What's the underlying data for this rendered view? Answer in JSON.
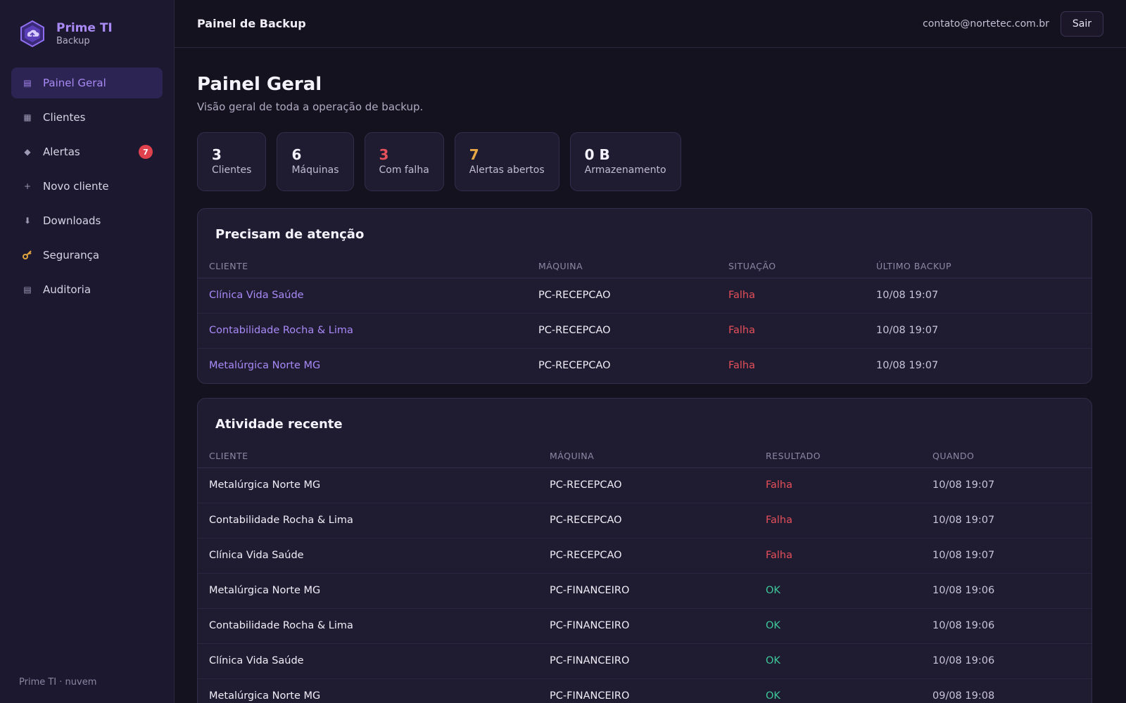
{
  "brand": {
    "name": "Prime TI",
    "subtitle": "Backup"
  },
  "sidebar": {
    "items": [
      {
        "label": "Painel Geral",
        "icon": "dashboard-icon",
        "active": true
      },
      {
        "label": "Clientes",
        "icon": "grid-icon"
      },
      {
        "label": "Alertas",
        "icon": "diamond-icon",
        "badge": "7"
      },
      {
        "label": "Novo cliente",
        "icon": "plus-icon"
      },
      {
        "label": "Downloads",
        "icon": "download-icon"
      },
      {
        "label": "Segurança",
        "icon": "key-icon"
      },
      {
        "label": "Auditoria",
        "icon": "list-icon"
      }
    ],
    "footer": "Prime TI · nuvem"
  },
  "topbar": {
    "title": "Painel de Backup",
    "user_email": "contato@nortetec.com.br",
    "logout_label": "Sair"
  },
  "page": {
    "title": "Painel Geral",
    "subtitle": "Visão geral de toda a operação de backup."
  },
  "stats": [
    {
      "value": "3",
      "label": "Clientes"
    },
    {
      "value": "6",
      "label": "Máquinas"
    },
    {
      "value": "3",
      "label": "Com falha",
      "color": "#e5505a"
    },
    {
      "value": "7",
      "label": "Alertas abertos",
      "color": "#e7a845"
    },
    {
      "value": "0 B",
      "label": "Armazenamento"
    }
  ],
  "attention": {
    "title": "Precisam de atenção",
    "columns": [
      "CLIENTE",
      "MÁQUINA",
      "SITUAÇÃO",
      "ÚLTIMO BACKUP"
    ],
    "rows": [
      {
        "client": "Clínica Vida Saúde",
        "machine": "PC-RECEPCAO",
        "status": "Falha",
        "last_backup": "10/08 19:07"
      },
      {
        "client": "Contabilidade Rocha & Lima",
        "machine": "PC-RECEPCAO",
        "status": "Falha",
        "last_backup": "10/08 19:07"
      },
      {
        "client": "Metalúrgica Norte MG",
        "machine": "PC-RECEPCAO",
        "status": "Falha",
        "last_backup": "10/08 19:07"
      }
    ]
  },
  "activity": {
    "title": "Atividade recente",
    "columns": [
      "CLIENTE",
      "MÁQUINA",
      "RESULTADO",
      "QUANDO"
    ],
    "rows": [
      {
        "client": "Metalúrgica Norte MG",
        "machine": "PC-RECEPCAO",
        "result": "Falha",
        "when": "10/08 19:07"
      },
      {
        "client": "Contabilidade Rocha & Lima",
        "machine": "PC-RECEPCAO",
        "result": "Falha",
        "when": "10/08 19:07"
      },
      {
        "client": "Clínica Vida Saúde",
        "machine": "PC-RECEPCAO",
        "result": "Falha",
        "when": "10/08 19:07"
      },
      {
        "client": "Metalúrgica Norte MG",
        "machine": "PC-FINANCEIRO",
        "result": "OK",
        "when": "10/08 19:06"
      },
      {
        "client": "Contabilidade Rocha & Lima",
        "machine": "PC-FINANCEIRO",
        "result": "OK",
        "when": "10/08 19:06"
      },
      {
        "client": "Clínica Vida Saúde",
        "machine": "PC-FINANCEIRO",
        "result": "OK",
        "when": "10/08 19:06"
      },
      {
        "client": "Metalúrgica Norte MG",
        "machine": "PC-FINANCEIRO",
        "result": "OK",
        "when": "09/08 19:08"
      }
    ]
  },
  "colors": {
    "accent": "#a98af5",
    "fail": "#e5505a",
    "ok": "#3ec99a",
    "warning": "#e7a845"
  }
}
